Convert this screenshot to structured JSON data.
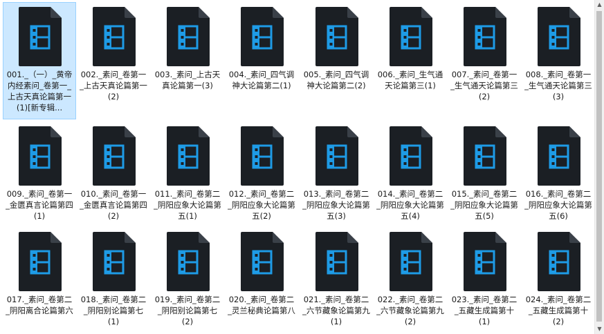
{
  "icon_name": "video-file-icon",
  "colors": {
    "icon_body": "#1b1f24",
    "icon_glyph": "#1e9be6",
    "selection_bg": "#cce8ff"
  },
  "files": [
    {
      "name": "001._（一）_黄帝内经素问_卷第一_上古天真论篇第一(1)[新专辑...",
      "selected": true
    },
    {
      "name": "002._素问_卷第一_上古天真论篇第一(2)",
      "selected": false
    },
    {
      "name": "003._素问_上古天真论篇第一(3)",
      "selected": false
    },
    {
      "name": "004._素问_四气调神大论篇第二(1)",
      "selected": false
    },
    {
      "name": "005._素问_四气调神大论篇第二(2)",
      "selected": false
    },
    {
      "name": "006._素问_生气通天论篇第三(1)",
      "selected": false
    },
    {
      "name": "007._素问_卷第一_生气通天论篇第三(2)",
      "selected": false
    },
    {
      "name": "008._素问_卷第一_生气通天论篇第三(3)",
      "selected": false
    },
    {
      "name": "009._素问_卷第一_金匮真言论篇第四(1)",
      "selected": false
    },
    {
      "name": "010._素问_卷第一_金匮真言论篇第四(2)",
      "selected": false
    },
    {
      "name": "011._素问_卷第二_阴阳应象大论篇第五(1)",
      "selected": false
    },
    {
      "name": "012._素问_卷第二_阴阳应象大论篇第五(2)",
      "selected": false
    },
    {
      "name": "013._素问_卷第二_阴阳应象大论篇第五(3)",
      "selected": false
    },
    {
      "name": "014._素问_卷第二_阴阳应象大论篇第五(4)",
      "selected": false
    },
    {
      "name": "015._素问_卷第二_阴阳应象大论篇第五(5)",
      "selected": false
    },
    {
      "name": "016._素问_卷第二_阴阳应象大论篇第五(6)",
      "selected": false
    },
    {
      "name": "017._素问_卷第二_阴阳离合论篇第六",
      "selected": false
    },
    {
      "name": "018._素问_卷第二_阴阳别论篇第七(1)",
      "selected": false
    },
    {
      "name": "019._素问_卷第二_阴阳别论篇第七(2)",
      "selected": false
    },
    {
      "name": "020._素问_卷第二_灵兰秘典论篇第八",
      "selected": false
    },
    {
      "name": "021._素问_卷第二_六节藏象论篇第九(1)",
      "selected": false
    },
    {
      "name": "022._素问_卷第二_六节藏象论篇第九(2)",
      "selected": false
    },
    {
      "name": "023._素问_卷第二_五藏生成篇第十(1)",
      "selected": false
    },
    {
      "name": "024._素问_卷第二_五藏生成篇第十(2)",
      "selected": false
    }
  ],
  "scrollbar": {
    "up_arrow": "▲",
    "down_arrow": "▼"
  }
}
